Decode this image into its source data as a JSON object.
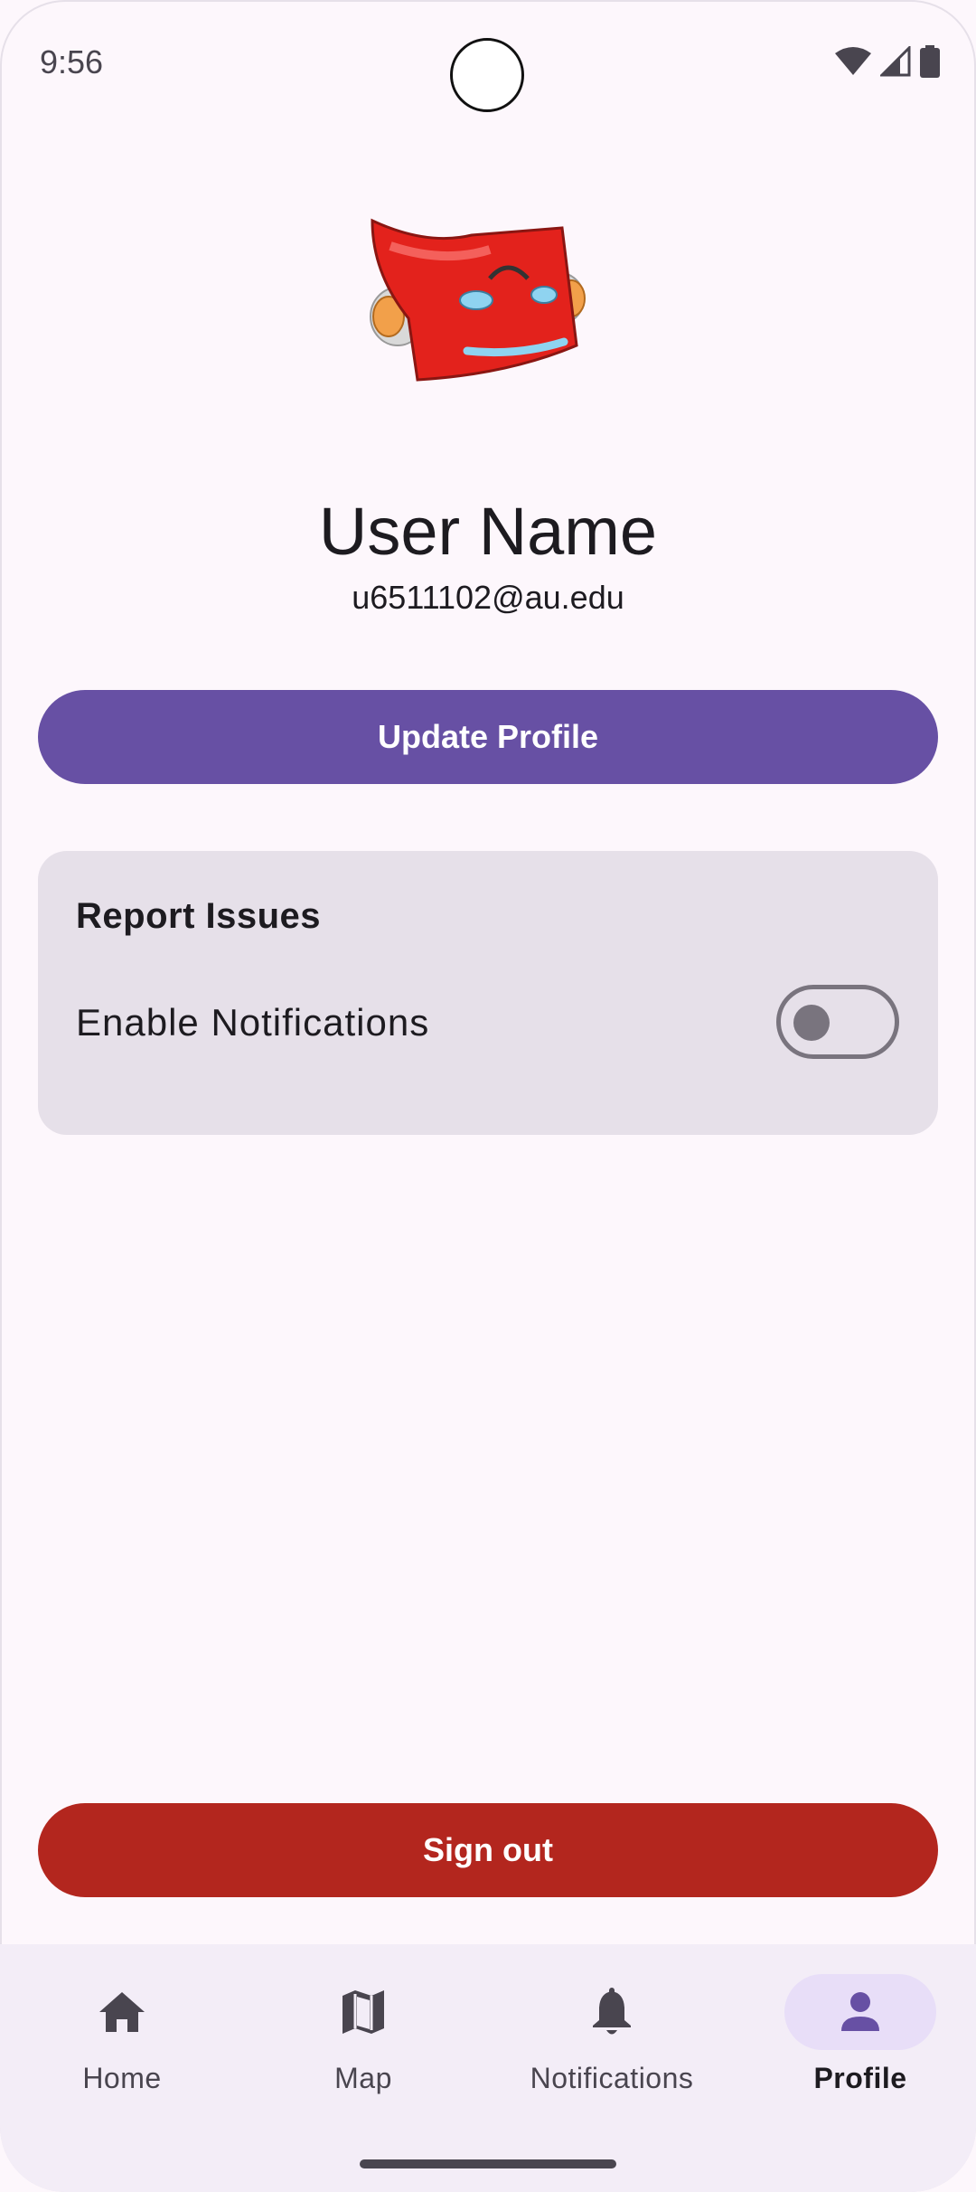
{
  "status_bar": {
    "time": "9:56",
    "icons": [
      "wifi-icon",
      "signal-icon",
      "battery-icon"
    ]
  },
  "profile": {
    "avatar_icon": "red-robot-head-mascot",
    "name": "User Name",
    "email": "u6511102@au.edu"
  },
  "actions": {
    "update_profile_label": "Update Profile",
    "sign_out_label": "Sign out"
  },
  "settings_card": {
    "title": "Report Issues",
    "notifications_label": "Enable Notifications",
    "notifications_enabled": false
  },
  "nav": {
    "items": [
      {
        "label": "Home",
        "icon": "home-icon",
        "active": false
      },
      {
        "label": "Map",
        "icon": "map-icon",
        "active": false
      },
      {
        "label": "Notifications",
        "icon": "bell-icon",
        "active": false
      },
      {
        "label": "Profile",
        "icon": "person-icon",
        "active": true
      }
    ]
  },
  "colors": {
    "primary": "#6750a4",
    "danger": "#b3261e",
    "background": "#fdf7fc",
    "card": "#e6e0e9",
    "nav_active_pill": "#e8def8"
  }
}
